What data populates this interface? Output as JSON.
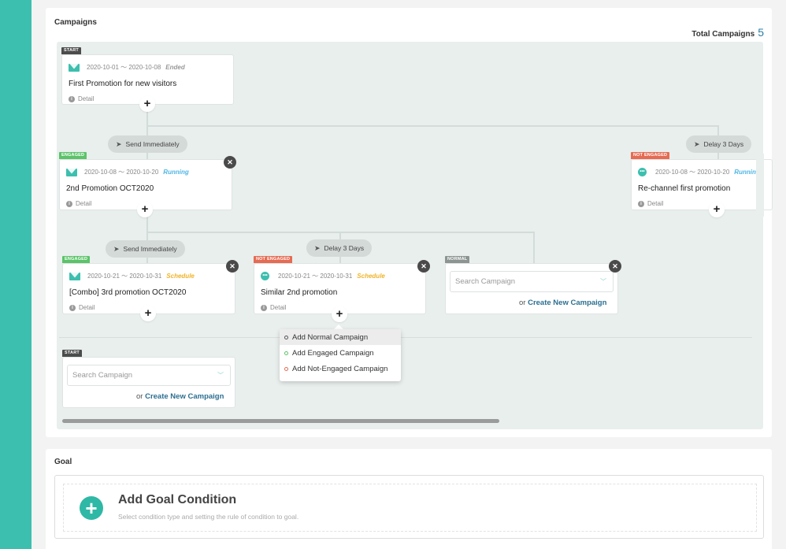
{
  "campaigns": {
    "title": "Campaigns",
    "total_label": "Total Campaigns",
    "total_value": "5"
  },
  "cards": {
    "first": {
      "tag": "START",
      "dates": "2020-10-01 ～ 2020-10-08",
      "status": "Ended",
      "name": "First Promotion for new visitors",
      "detail": "Detail"
    },
    "second": {
      "tag": "ENGAGED",
      "dates": "2020-10-08 ～ 2020-10-20",
      "status": "Running",
      "name": "2nd Promotion OCT2020",
      "detail": "Detail"
    },
    "rechannel": {
      "tag": "NOT ENGAGED",
      "dates": "2020-10-08 ～ 2020-10-20",
      "status": "Running",
      "name": "Re-channel first promotion",
      "detail": "Detail"
    },
    "third": {
      "tag": "ENGAGED",
      "dates": "2020-10-21 ～ 2020-10-31",
      "status": "Schedule",
      "name": "[Combo] 3rd promotion OCT2020",
      "detail": "Detail"
    },
    "similar": {
      "tag": "NOT ENGAGED",
      "dates": "2020-10-21 ～ 2020-10-31",
      "status": "Schedule",
      "name": "Similar 2nd promotion",
      "detail": "Detail"
    }
  },
  "pills": {
    "send1": "Send Immediately",
    "delay1": "Delay 3 Days",
    "send2": "Send Immediately",
    "delay2": "Delay 3 Days"
  },
  "normal_card": {
    "tag": "NORMAL",
    "search_placeholder": "Search Campaign",
    "or_text": "or",
    "create_label": "Create New Campaign"
  },
  "start_card": {
    "tag": "START",
    "search_placeholder": "Search Campaign",
    "or_text": "or",
    "create_label": "Create New Campaign"
  },
  "dropdown": {
    "options": [
      "Add Normal Campaign",
      "Add Engaged Campaign",
      "Add Not-Engaged Campaign"
    ]
  },
  "goal": {
    "title": "Goal",
    "add_title": "Add Goal Condition",
    "add_subtitle": "Select condition type and setting the rule of condition to goal."
  },
  "colors": {
    "accent": "#3cbfae",
    "engaged": "#5cc36a",
    "not_engaged": "#e66b53",
    "running": "#4fb6e4",
    "schedule": "#f0b429"
  }
}
